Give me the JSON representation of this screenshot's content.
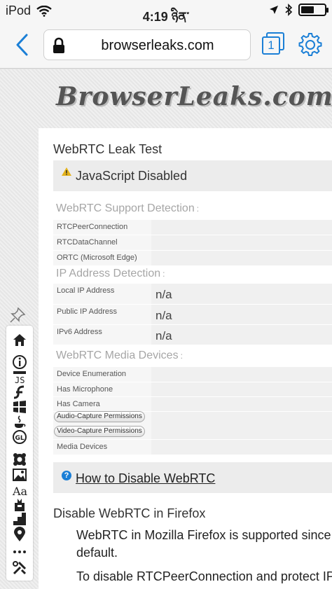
{
  "status_bar": {
    "carrier": "iPod",
    "time": "4:19 ཉིན་",
    "battery_level": 0.55
  },
  "toolbar": {
    "url": "browserleaks.com",
    "tab_count": "1"
  },
  "page": {
    "logo_text": "BrowserLeaks.com",
    "title": "WebRTC Leak Test",
    "warning": "JavaScript Disabled",
    "support": {
      "heading": "WebRTC Support Detection",
      "colon": ":",
      "rows": [
        "RTCPeerConnection",
        "RTCDataChannel",
        "ORTC (Microsoft Edge)"
      ]
    },
    "ip": {
      "heading": "IP Address Detection",
      "colon": ":",
      "rows": [
        {
          "label": "Local IP Address",
          "value": "n/a"
        },
        {
          "label": "Public IP Address",
          "value": "n/a"
        },
        {
          "label": "IPv6 Address",
          "value": "n/a"
        }
      ]
    },
    "media": {
      "heading": "WebRTC Media Devices",
      "colon": ":",
      "rows": [
        "Device Enumeration",
        "Has Microphone",
        "Has Camera"
      ],
      "buttons": [
        "Audio-Capture Permissions",
        "Video-Capture Permissions"
      ],
      "last_row": "Media Devices"
    },
    "how_link": "How to Disable WebRTC",
    "firefox_heading": "Disable WebRTC in Firefox",
    "para_line1": "WebRTC in Mozilla Firefox is supported since",
    "para_line2": "default.",
    "para_line3": "To disable RTCPeerConnection and protect IP"
  },
  "dock": {
    "icons": [
      "home-icon",
      "info-icon",
      "javascript-icon",
      "flash-icon",
      "windows-icon",
      "java-icon",
      "webgl-icon",
      "canvas-icon",
      "image-icon",
      "fonts-icon",
      "geo-icon",
      "location-icon",
      "more-icon",
      "tools-icon"
    ]
  },
  "colors": {
    "accent": "#1b7fd6",
    "banner_bg": "#ececec",
    "row_bg": "#f6f6f6"
  }
}
